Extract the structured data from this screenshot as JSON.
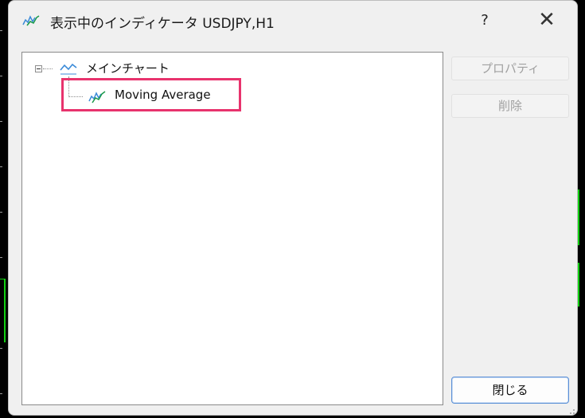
{
  "window": {
    "title": "表示中のインディケータ USDJPY,H1",
    "help_label": "?",
    "close_label": "✕"
  },
  "tree": {
    "root": {
      "label": "メインチャート",
      "icon": "chart-line-icon",
      "expanded": true
    },
    "children": [
      {
        "label": "Moving Average",
        "icon": "moving-average-icon",
        "highlighted": true
      }
    ]
  },
  "buttons": {
    "properties_label": "プロパティ",
    "delete_label": "削除",
    "close_label": "閉じる"
  },
  "colors": {
    "highlight": "#e8336d",
    "icon_line": "#3a8ad8",
    "icon_ma": "#1a9a4a",
    "chart_candle": "#12d012"
  }
}
